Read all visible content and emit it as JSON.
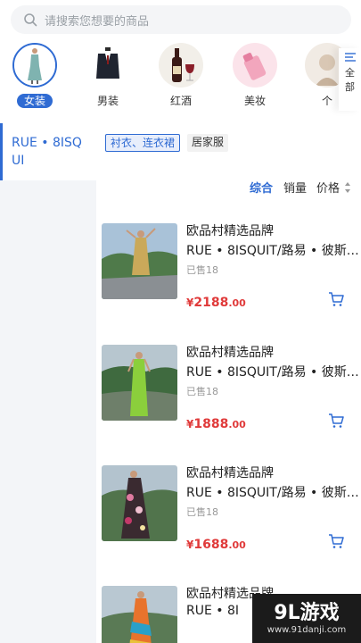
{
  "search": {
    "placeholder": "请搜索您想要的商品"
  },
  "categories": [
    {
      "label": "女装",
      "selected": true
    },
    {
      "label": "男装",
      "selected": false
    },
    {
      "label": "红酒",
      "selected": false
    },
    {
      "label": "美妆",
      "selected": false
    },
    {
      "label": "个",
      "selected": false
    }
  ],
  "all_categories": {
    "label_line1": "全",
    "label_line2": "部"
  },
  "sidebar": {
    "items": [
      {
        "label": "RUE • 8ISQUI",
        "selected": true
      }
    ]
  },
  "sub_tabs": [
    {
      "label": "衬衣、连衣裙",
      "selected": true
    },
    {
      "label": "居家服",
      "selected": false
    }
  ],
  "sort": {
    "comprehensive": "综合",
    "sales": "销量",
    "price": "价格"
  },
  "products": [
    {
      "brand": "欧品村精选品牌",
      "name": "RUE • 8ISQUIT/路易 • 彼斯…",
      "sold": "已售18",
      "currency": "¥",
      "price_int": "2188",
      "price_dec": ".00"
    },
    {
      "brand": "欧品村精选品牌",
      "name": "RUE • 8ISQUIT/路易 • 彼斯…",
      "sold": "已售18",
      "currency": "¥",
      "price_int": "1888",
      "price_dec": ".00"
    },
    {
      "brand": "欧品村精选品牌",
      "name": "RUE • 8ISQUIT/路易 • 彼斯…",
      "sold": "已售18",
      "currency": "¥",
      "price_int": "1688",
      "price_dec": ".00"
    },
    {
      "brand": "欧品村精选品牌",
      "name": "RUE • 8I",
      "sold": "",
      "currency": "",
      "price_int": "",
      "price_dec": ""
    }
  ],
  "watermark": {
    "logo": "9L游戏",
    "url": "www.91danji.com"
  },
  "colors": {
    "accent": "#2f6bd3",
    "price": "#e03a3a",
    "sidebar_bg": "#f3f5f8"
  }
}
